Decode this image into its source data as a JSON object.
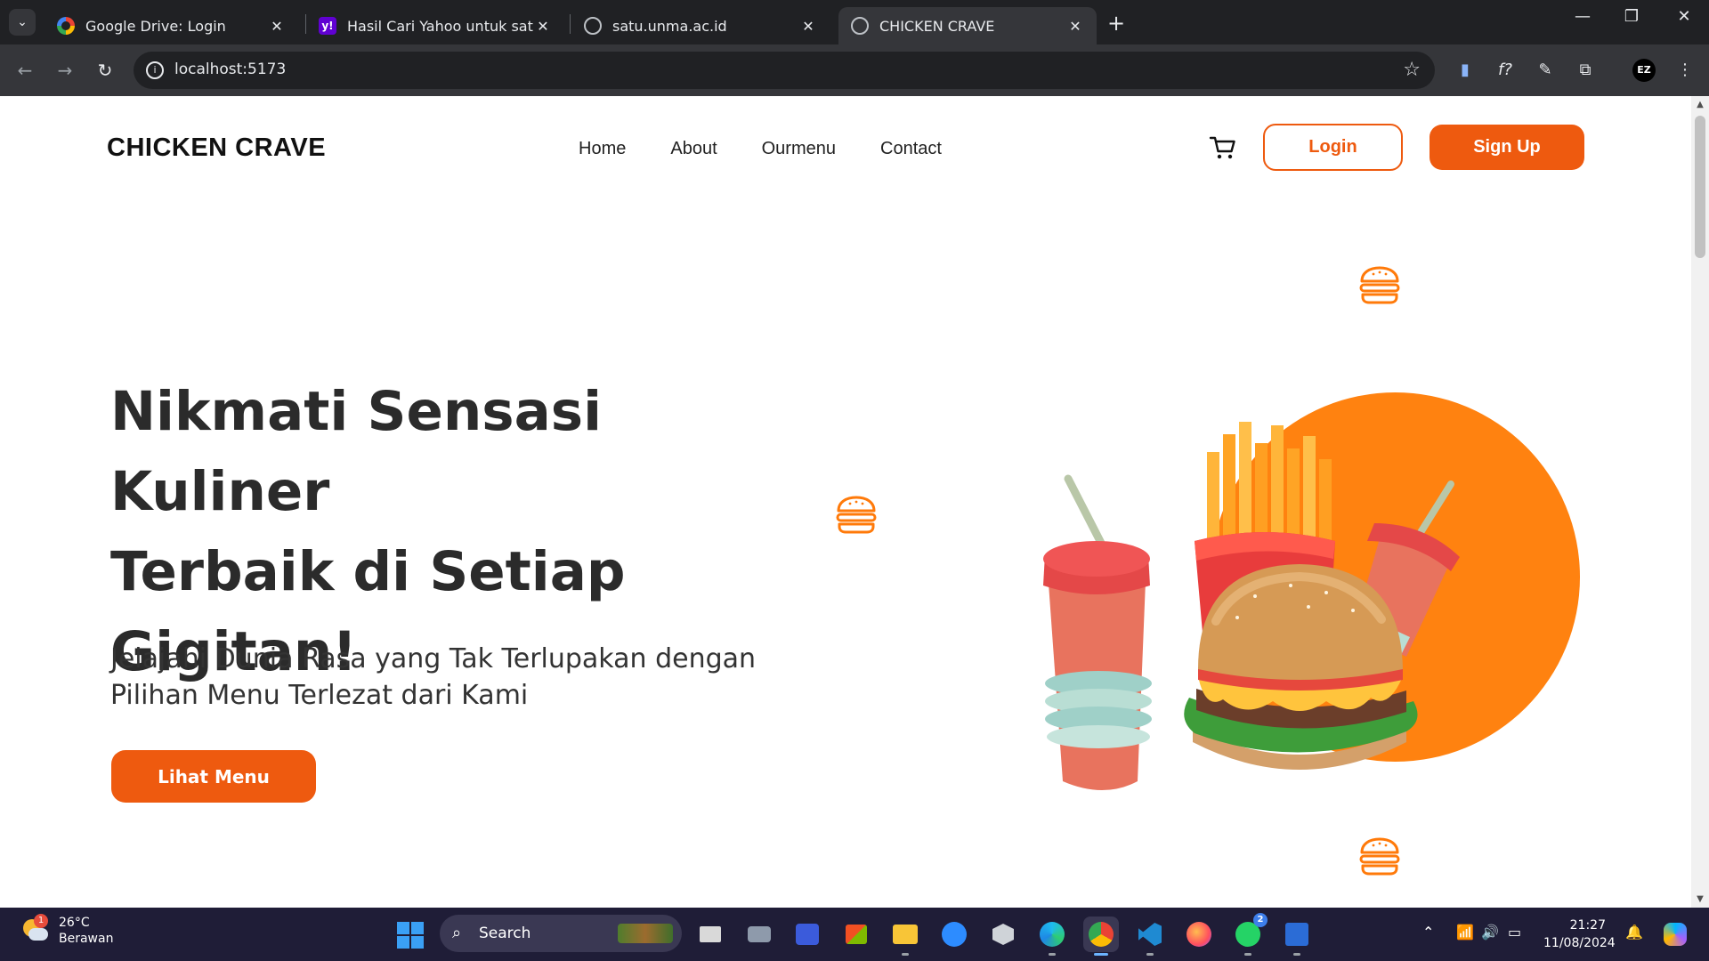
{
  "browser": {
    "tabs": [
      {
        "title": "Google Drive: Login",
        "favicon": "google-icon"
      },
      {
        "title": "Hasil Cari Yahoo untuk satu unm",
        "favicon": "yahoo-icon"
      },
      {
        "title": "satu.unma.ac.id",
        "favicon": "globe-icon"
      },
      {
        "title": "CHICKEN CRAVE",
        "favicon": "globe-icon",
        "active": true
      }
    ],
    "url": "localhost:5173",
    "profile_initials": "EZ"
  },
  "site": {
    "logo": "CHICKEN CRAVE",
    "nav": [
      "Home",
      "About",
      "Ourmenu",
      "Contact"
    ],
    "login_label": "Login",
    "signup_label": "Sign Up",
    "accent_color": "#EE5A0F",
    "circle_color": "#FF8210"
  },
  "hero": {
    "title_lines": [
      "Nikmati Sensasi Kuliner",
      "Terbaik di Setiap",
      "Gigitan!"
    ],
    "subtitle_lines": [
      "Jelajahi Dunia Rasa yang Tak Terlupakan dengan",
      "Pilihan Menu Terlezat dari Kami"
    ],
    "cta_label": "Lihat Menu"
  },
  "taskbar": {
    "weather_temp": "26°C",
    "weather_desc": "Berawan",
    "weather_badge": "1",
    "search_label": "Search",
    "whatsapp_badge": "2",
    "time": "21:27",
    "date": "11/08/2024"
  }
}
